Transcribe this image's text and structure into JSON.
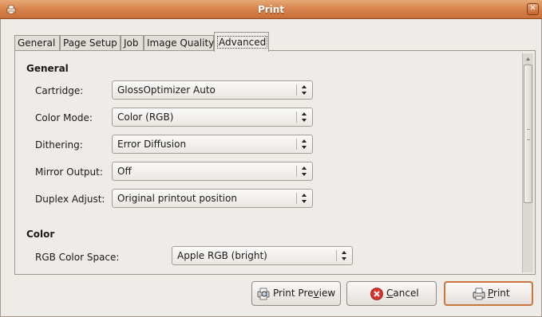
{
  "window": {
    "title": "Print"
  },
  "tabs": [
    {
      "label": "General"
    },
    {
      "label": "Page Setup"
    },
    {
      "label": "Job"
    },
    {
      "label": "Image Quality"
    },
    {
      "label": "Advanced"
    }
  ],
  "active_tab": "Advanced",
  "sections": {
    "general": {
      "title": "General",
      "rows": [
        {
          "label": "Cartridge:",
          "value": "GlossOptimizer Auto"
        },
        {
          "label": "Color Mode:",
          "value": "Color (RGB)"
        },
        {
          "label": "Dithering:",
          "value": "Error Diffusion"
        },
        {
          "label": "Mirror Output:",
          "value": "Off"
        },
        {
          "label": "Duplex Adjust:",
          "value": "Original printout position"
        }
      ]
    },
    "color": {
      "title": "Color",
      "rows": [
        {
          "label": "RGB Color Space:",
          "value": "Apple RGB (bright)"
        }
      ]
    }
  },
  "buttons": {
    "preview": {
      "before": "Print Pre",
      "mnemonic": "v",
      "after": "iew"
    },
    "cancel": {
      "before": "",
      "mnemonic": "C",
      "after": "ancel"
    },
    "print": {
      "before": "",
      "mnemonic": "P",
      "after": "rint"
    }
  },
  "colors": {
    "titlebar": "#d7824b",
    "default_button_border": "#c8763e",
    "cancel_icon": "#d9322a"
  },
  "icons": {
    "window_menu": "printer-icon",
    "close": "close-icon",
    "preview": "print-preview-icon",
    "cancel": "cancel-icon",
    "print": "printer-icon"
  }
}
